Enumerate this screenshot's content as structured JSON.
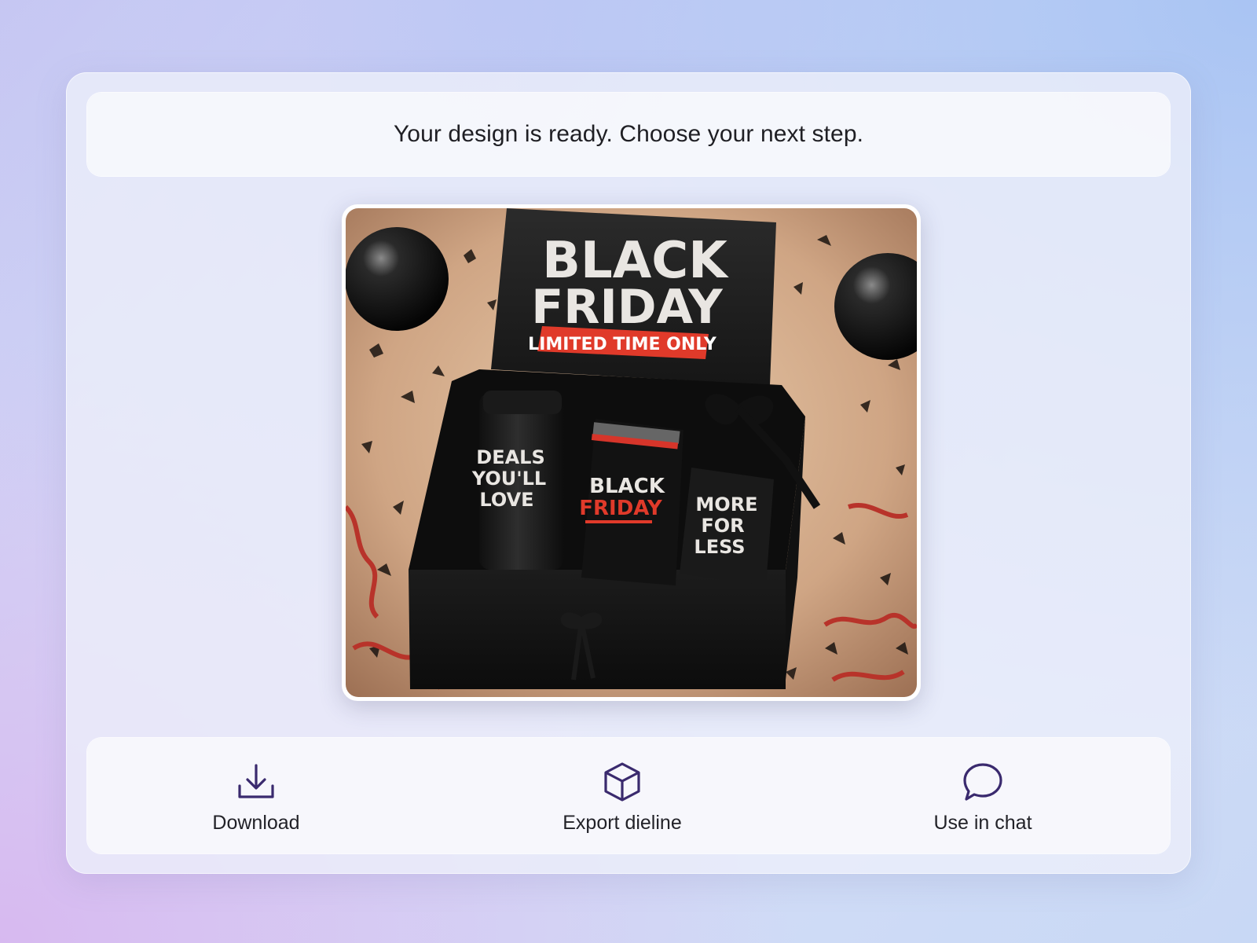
{
  "header": {
    "message": "Your design is ready. Choose your next step."
  },
  "preview": {
    "lid": {
      "line1": "BLACK",
      "line2": "FRIDAY",
      "banner": "LIMITED TIME ONLY"
    },
    "tumbler": [
      "DEALS",
      "YOU'LL",
      "LOVE"
    ],
    "sock": [
      "BLACK",
      "FRIDAY"
    ],
    "tag": [
      "MORE",
      "FOR",
      "LESS"
    ]
  },
  "actions": [
    {
      "label": "Download",
      "icon": "download-icon"
    },
    {
      "label": "Export dieline",
      "icon": "cube-icon"
    },
    {
      "label": "Use in chat",
      "icon": "chat-bubble-icon"
    }
  ],
  "colors": {
    "accent_icon": "#3a2a6e",
    "banner_red": "#e03a2a"
  }
}
